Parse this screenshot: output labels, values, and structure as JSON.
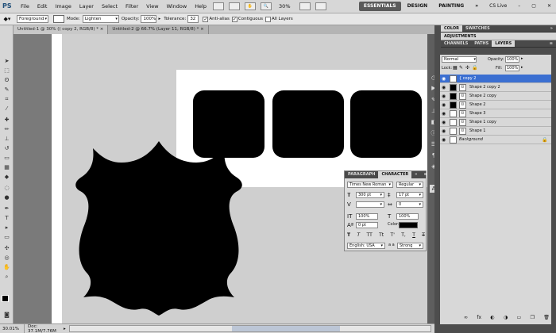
{
  "menubar": {
    "logo": "PS",
    "items": [
      "File",
      "Edit",
      "Image",
      "Layer",
      "Select",
      "Filter",
      "View",
      "Window",
      "Help"
    ],
    "zoom": "30%",
    "workspaces": [
      "ESSENTIALS",
      "DESIGN",
      "PAINTING"
    ],
    "cs_live": "CS Live"
  },
  "options": {
    "fill_source": "Foreground",
    "mode_label": "Mode:",
    "mode_value": "Lighten",
    "opacity_label": "Opacity:",
    "opacity_value": "100%",
    "tolerance_label": "Tolerance:",
    "tolerance_value": "32",
    "antialias_label": "Anti-alias",
    "contiguous_label": "Contiguous",
    "all_layers_label": "All Layers"
  },
  "doc_tabs": [
    "Untitled-1 @ 30% (( copy 2, RGB/8) *",
    "Untitled-2 @ 66.7% (Layer 11, RGB/8) *"
  ],
  "status": {
    "zoom": "30.01%",
    "doc": "Doc: 37.1M/7.76M"
  },
  "panels": {
    "top_tabs": [
      "COLOR",
      "SWATCHES"
    ],
    "adjustments": "ADJUSTMENTS",
    "layer_tabs": [
      "CHANNELS",
      "PATHS",
      "LAYERS"
    ],
    "blend_mode": "Normal",
    "opacity_label": "Opacity:",
    "opacity_value": "100%",
    "lock_label": "Lock:",
    "fill_label": "Fill:",
    "fill_value": "100%"
  },
  "layers": [
    {
      "name": "{ copy 2",
      "selected": true,
      "thumb": "white"
    },
    {
      "name": "Shape 2 copy 2",
      "selected": false,
      "thumb": "black"
    },
    {
      "name": "Shape 2 copy",
      "selected": false,
      "thumb": "black"
    },
    {
      "name": "Shape 2",
      "selected": false,
      "thumb": "black"
    },
    {
      "name": "Shape 3",
      "selected": false,
      "thumb": "white"
    },
    {
      "name": "Shape 1 copy",
      "selected": false,
      "thumb": "white"
    },
    {
      "name": "Shape 1",
      "selected": false,
      "thumb": "white"
    },
    {
      "name": "Background",
      "selected": false,
      "thumb": "white"
    }
  ],
  "character": {
    "tabs": [
      "PARAGRAPH",
      "CHARACTER"
    ],
    "font": "Times New Roman",
    "style": "Regular",
    "size": "300 pt",
    "leading": "17 pt",
    "tracking": "0",
    "vscale": "100%",
    "hscale": "100%",
    "baseline": "0 pt",
    "color_label": "Color:",
    "style_buttons": [
      "T",
      "T",
      "TT",
      "Tt",
      "T'",
      "T,",
      "T",
      "T"
    ],
    "language": "English: USA",
    "aa_prefix": "a a",
    "antialias": "Strong"
  }
}
